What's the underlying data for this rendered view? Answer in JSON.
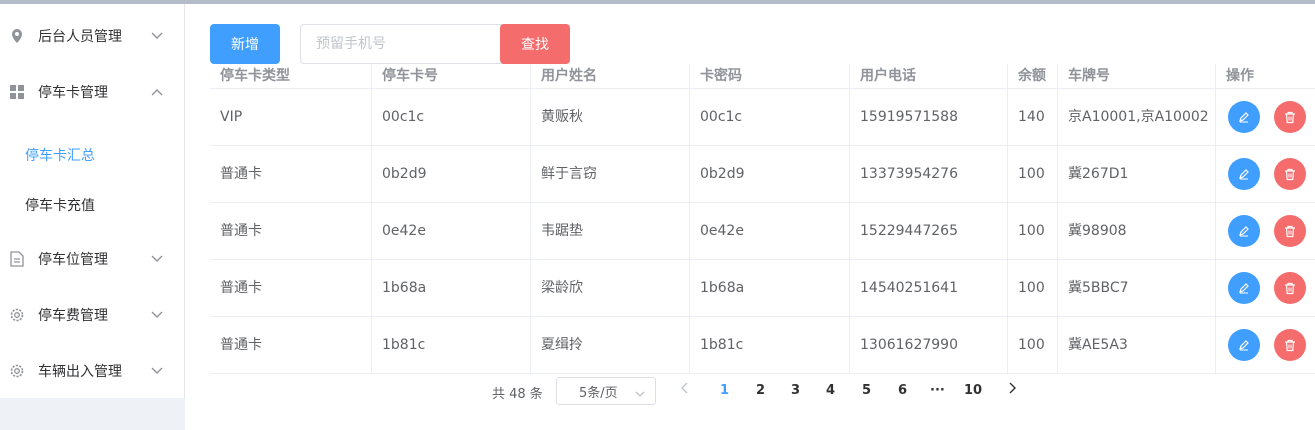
{
  "sidebar": {
    "items": [
      {
        "label": "后台人员管理"
      },
      {
        "label": "停车卡管理"
      },
      {
        "label": "停车位管理"
      },
      {
        "label": "停车费管理"
      },
      {
        "label": "车辆出入管理"
      }
    ],
    "sub_items": [
      {
        "label": "停车卡汇总"
      },
      {
        "label": "停车卡充值"
      }
    ]
  },
  "toolbar": {
    "add_label": "新增",
    "search_placeholder": "预留手机号",
    "search_label": "查找"
  },
  "table": {
    "columns": [
      "停车卡类型",
      "停车卡号",
      "用户姓名",
      "卡密码",
      "用户电话",
      "余额",
      "车牌号",
      "操作"
    ],
    "rows": [
      [
        "VIP",
        "00c1c",
        "黄贩秋",
        "00c1c",
        "15919571588",
        "140",
        "京A10001,京A10002"
      ],
      [
        "普通卡",
        "0b2d9",
        "鲜于言窃",
        "0b2d9",
        "13373954276",
        "100",
        "冀267D1"
      ],
      [
        "普通卡",
        "0e42e",
        "韦踞垫",
        "0e42e",
        "15229447265",
        "100",
        "冀98908"
      ],
      [
        "普通卡",
        "1b68a",
        "梁龄欣",
        "1b68a",
        "14540251641",
        "100",
        "冀5BBC7"
      ],
      [
        "普通卡",
        "1b81c",
        "夏缉拎",
        "1b81c",
        "13061627990",
        "100",
        "冀AE5A3"
      ]
    ]
  },
  "pagination": {
    "total": "共 48 条",
    "page_size": "5条/页",
    "pages": [
      "1",
      "2",
      "3",
      "4",
      "5",
      "6",
      "···",
      "10"
    ],
    "current": "1"
  },
  "colors": {
    "primary": "#409eff",
    "danger": "#f56c6c"
  }
}
